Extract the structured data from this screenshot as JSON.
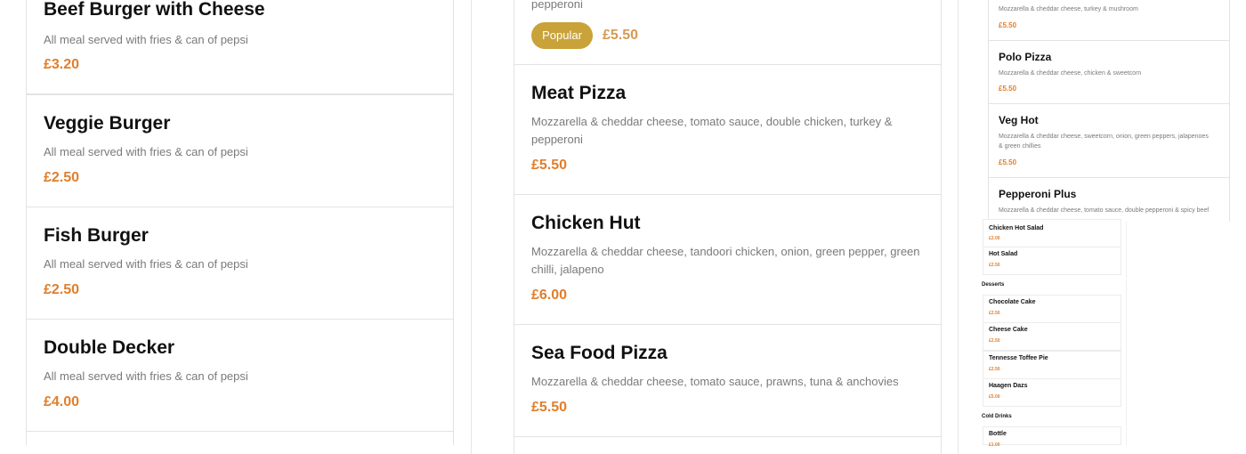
{
  "burgers": [
    {
      "name": "Beef Burger with Cheese",
      "desc": "All meal served with fries & can of pepsi",
      "price": "£3.20"
    },
    {
      "name": "Veggie Burger",
      "desc": "All meal served with fries & can of pepsi",
      "price": "£2.50"
    },
    {
      "name": "Fish Burger",
      "desc": "All meal served with fries & can of pepsi",
      "price": "£2.50"
    },
    {
      "name": "Double Decker",
      "desc": "All meal served with fries & can of pepsi",
      "price": "£4.00"
    }
  ],
  "pizzas": {
    "top_item": {
      "desc_tail": "pepperoni",
      "badge": "Popular",
      "price": "£5.50"
    },
    "items": [
      {
        "name": "Meat Pizza",
        "desc1": "Mozzarella & cheddar cheese, tomato sauce, double chicken, turkey &",
        "desc2": "pepperoni",
        "price": "£5.50"
      },
      {
        "name": "Chicken Hut",
        "desc1": "Mozzarella & cheddar cheese, tandoori chicken, onion, green pepper, green",
        "desc2": "chilli, jalapeno",
        "price": "£6.00"
      },
      {
        "name": "Sea Food Pizza",
        "desc1": "Mozzarella & cheddar cheese, tomato sauce, prawns, tuna & anchovies",
        "price": "£5.50"
      }
    ]
  },
  "small_pizzas": {
    "top_item": {
      "desc": "Mozzarella & cheddar cheese, turkey & mushroom",
      "price": "£5.50"
    },
    "items": [
      {
        "name": "Polo Pizza",
        "desc1": "Mozzarella & cheddar cheese, chicken & sweetcorn",
        "price": "£5.50"
      },
      {
        "name": "Veg Hot",
        "desc1": "Mozzarella & cheddar cheese, sweetcorn, onion, green peppers, jalapenoes",
        "desc2": "& green chillies",
        "price": "£5.50"
      },
      {
        "name": "Pepperoni Plus",
        "desc1": "Mozzarella & cheddar cheese, tomato sauce, double pepperoni & spicy beef"
      }
    ]
  },
  "tiny_menu": {
    "salads": [
      {
        "name": "Chicken Hot Salad",
        "price": "£2.00"
      },
      {
        "name": "Hot Salad",
        "price": "£2.50"
      }
    ],
    "desserts_heading": "Desserts",
    "desserts": [
      {
        "name": "Chocolate Cake",
        "price": "£2.50"
      },
      {
        "name": "Cheese Cake",
        "price": "£2.50"
      },
      {
        "name": "Tennesse Toffee Pie",
        "price": "£2.50"
      },
      {
        "name": "Haagen Dazs",
        "price": "£5.00"
      }
    ],
    "drinks_heading": "Cold Drinks",
    "drinks": [
      {
        "name": "Bottle",
        "price": "£1.00"
      }
    ]
  }
}
